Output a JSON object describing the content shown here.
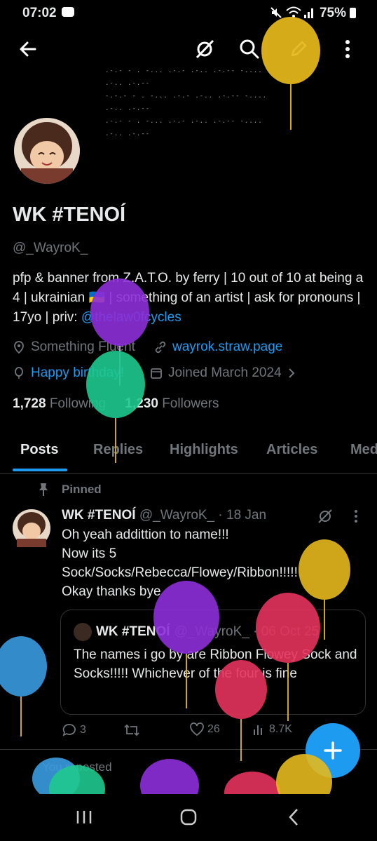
{
  "status_bar": {
    "time": "07:02",
    "battery": "75%"
  },
  "banner": {
    "lines": [
      ".-.- - . -... .-.- .-.. .-.-- -.... .-.. .-.--",
      "-.-.- - . -... .-.- .-.. .-.-- -.... .-.. .-.--",
      ".-.- - . -... .-.- .-.. .-.-- -.... .-.. .-.--"
    ]
  },
  "profile": {
    "name": "WK #TENOÍ",
    "handle": "@_WayroK_",
    "bio_text": "pfp & banner from Z.A.T.O. by ferry | 10 out of 10 at being a 4 | ukrainian 🇺🇦 | something of an artist | ask for pronouns | 17yo | priv: ",
    "bio_link": "@thelaw0fcycles",
    "location": "Something Fluent",
    "website": "wayrok.straw.page",
    "birthday": "Happy birthday!",
    "joined": "Joined March 2024",
    "following_count": "1,728",
    "following_label": "Following",
    "followers_count": "1,230",
    "followers_label": "Followers"
  },
  "tabs": [
    {
      "label": "Posts"
    },
    {
      "label": "Replies"
    },
    {
      "label": "Highlights"
    },
    {
      "label": "Articles"
    },
    {
      "label": "Media"
    }
  ],
  "tweet": {
    "pinned_label": "Pinned",
    "name": "WK #TENOÍ",
    "handle_date": "@_WayroK_ · 18 Jan",
    "body": "Oh yeah addittion to name!!!\nNow its 5\nSock/Socks/Rebecca/Flowey/Ribbon!!!!!\nOkay thanks bye",
    "quote": {
      "name": "WK #TENOÍ",
      "handle_date": "@_WayroK_ · 06 Oct 25",
      "body": "The names i go by are Ribbon Flowey Sock and Socks!!!!! Whichever of the four is fine"
    },
    "replies": "3",
    "likes": "26",
    "views": "8.7K"
  },
  "next_item": {
    "repost_label": "You reposted"
  },
  "colors": {
    "accent": "#1d9bf0",
    "background": "#000000",
    "muted": "#71767b",
    "text": "#e7e9ea"
  }
}
